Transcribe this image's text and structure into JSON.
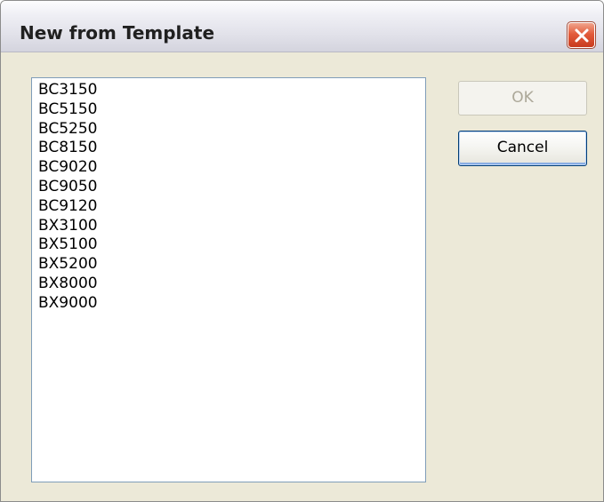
{
  "dialog": {
    "title": "New from Template",
    "close_icon": "close-icon",
    "accent_close": "#e35c3c"
  },
  "template_list": {
    "items": [
      "BC3150",
      "BC5150",
      "BC5250",
      "BC8150",
      "BC9020",
      "BC9050",
      "BC9120",
      "BX3100",
      "BX5100",
      "BX5200",
      "BX8000",
      "BX9000"
    ]
  },
  "buttons": {
    "ok_label": "OK",
    "ok_enabled": false,
    "cancel_label": "Cancel"
  }
}
